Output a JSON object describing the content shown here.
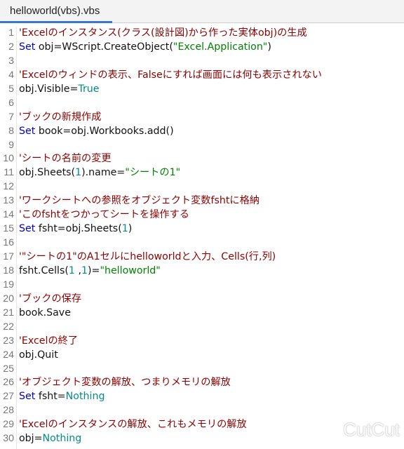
{
  "tab": {
    "title": "helloworld(vbs).vbs"
  },
  "colors": {
    "comment": "#8b0000",
    "keyword": "#0000cd",
    "string": "#008000",
    "literal": "#008b8b",
    "tab_accent": "#3a76d6"
  },
  "lines": [
    {
      "n": "1",
      "tokens": [
        {
          "t": "c",
          "v": "'Excelのインスタンス(クラス(設計図)から作った実体obj)の生成"
        }
      ]
    },
    {
      "n": "2",
      "tokens": [
        {
          "t": "k",
          "v": "Set"
        },
        {
          "t": "p",
          "v": " obj=WScript.CreateObject("
        },
        {
          "t": "s",
          "v": "\"Excel.Application\""
        },
        {
          "t": "p",
          "v": ")"
        }
      ]
    },
    {
      "n": "3",
      "tokens": []
    },
    {
      "n": "4",
      "tokens": [
        {
          "t": "c",
          "v": "'Excelのウィンドの表示、Falseにすれば画面には何も表示されない"
        }
      ]
    },
    {
      "n": "5",
      "tokens": [
        {
          "t": "p",
          "v": "obj.Visible="
        },
        {
          "t": "l",
          "v": "True"
        }
      ]
    },
    {
      "n": "6",
      "tokens": []
    },
    {
      "n": "7",
      "tokens": [
        {
          "t": "c",
          "v": "'ブックの新規作成"
        }
      ]
    },
    {
      "n": "8",
      "tokens": [
        {
          "t": "k",
          "v": "Set"
        },
        {
          "t": "p",
          "v": " book=obj.Workbooks.add()"
        }
      ]
    },
    {
      "n": "9",
      "tokens": []
    },
    {
      "n": "10",
      "tokens": [
        {
          "t": "c",
          "v": "'シートの名前の変更"
        }
      ]
    },
    {
      "n": "11",
      "tokens": [
        {
          "t": "p",
          "v": "obj.Sheets("
        },
        {
          "t": "l",
          "v": "1"
        },
        {
          "t": "p",
          "v": ").name="
        },
        {
          "t": "s",
          "v": "\"シートの1\""
        }
      ]
    },
    {
      "n": "12",
      "tokens": []
    },
    {
      "n": "13",
      "tokens": [
        {
          "t": "c",
          "v": "'ワークシートへの参照をオブジェクト変数fshtに格納"
        }
      ]
    },
    {
      "n": "14",
      "tokens": [
        {
          "t": "c",
          "v": "'このfshtをつかってシートを操作する"
        }
      ]
    },
    {
      "n": "15",
      "tokens": [
        {
          "t": "k",
          "v": "Set"
        },
        {
          "t": "p",
          "v": " fsht=obj.Sheets("
        },
        {
          "t": "l",
          "v": "1"
        },
        {
          "t": "p",
          "v": ")"
        }
      ]
    },
    {
      "n": "16",
      "tokens": []
    },
    {
      "n": "17",
      "tokens": [
        {
          "t": "c",
          "v": "'\"シートの1\"のA1セルにhelloworldと入力、Cells(行,列)"
        }
      ]
    },
    {
      "n": "18",
      "tokens": [
        {
          "t": "p",
          "v": "fsht.Cells("
        },
        {
          "t": "l",
          "v": "1"
        },
        {
          "t": "p",
          "v": " ,"
        },
        {
          "t": "l",
          "v": "1"
        },
        {
          "t": "p",
          "v": ")="
        },
        {
          "t": "s",
          "v": "\"helloworld\""
        }
      ]
    },
    {
      "n": "19",
      "tokens": []
    },
    {
      "n": "20",
      "tokens": [
        {
          "t": "c",
          "v": "'ブックの保存"
        }
      ]
    },
    {
      "n": "21",
      "tokens": [
        {
          "t": "p",
          "v": "book.Save"
        }
      ]
    },
    {
      "n": "22",
      "tokens": []
    },
    {
      "n": "23",
      "tokens": [
        {
          "t": "c",
          "v": "'Excelの終了"
        }
      ]
    },
    {
      "n": "24",
      "tokens": [
        {
          "t": "p",
          "v": "obj.Quit"
        }
      ]
    },
    {
      "n": "25",
      "tokens": []
    },
    {
      "n": "26",
      "tokens": [
        {
          "t": "c",
          "v": "'オブジェクト変数の解放、つまりメモリの解放"
        }
      ]
    },
    {
      "n": "27",
      "tokens": [
        {
          "t": "k",
          "v": "Set"
        },
        {
          "t": "p",
          "v": " fsht="
        },
        {
          "t": "l",
          "v": "Nothing"
        }
      ]
    },
    {
      "n": "28",
      "tokens": []
    },
    {
      "n": "29",
      "tokens": [
        {
          "t": "c",
          "v": "'Excelのインスタンスの解放、これもメモリの解放"
        }
      ]
    },
    {
      "n": "30",
      "tokens": [
        {
          "t": "p",
          "v": "obj="
        },
        {
          "t": "l",
          "v": "Nothing"
        }
      ]
    }
  ],
  "watermark": {
    "text": "CutCut"
  }
}
